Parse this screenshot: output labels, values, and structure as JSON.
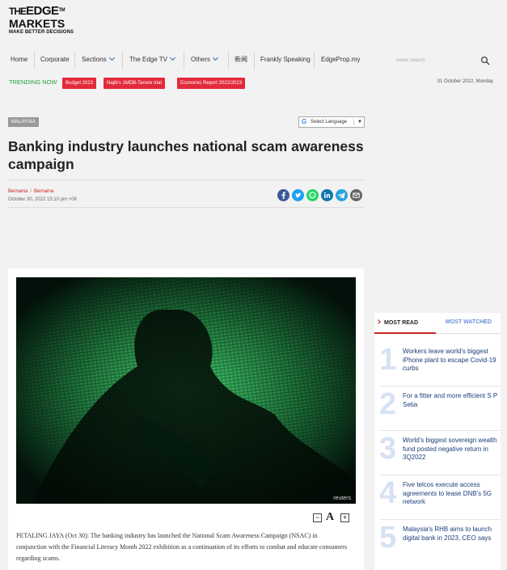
{
  "brand": {
    "line1_prefix": "THE",
    "line1_main": "EDGE",
    "tm": "TM",
    "line2": "MARKETS",
    "tagline": "MAKE BETTER DECISIONS"
  },
  "nav": {
    "items": [
      {
        "label": "Home"
      },
      {
        "label": "Corporate"
      },
      {
        "label": "Sections"
      },
      {
        "label": "The Edge TV"
      },
      {
        "label": "Others"
      },
      {
        "label": "新闻"
      },
      {
        "label": "Frankly Speaking"
      },
      {
        "label": "EdgeProp.my"
      }
    ],
    "search_placeholder": "News Search"
  },
  "trending": {
    "label": "TRENDING NOW",
    "tags": [
      "Budget 2023",
      "Najib's 1MDB-Tanore trial",
      "Economic Report 2022/2023"
    ],
    "date": "31 October 2022, Monday"
  },
  "article": {
    "category": "MALAYSIA",
    "language_selector": "Select Language",
    "language_arrow": "▼",
    "title": "Banking industry launches national scam awareness campaign",
    "author1": "Bernama",
    "author2": "Bernama",
    "byline_separator": "/",
    "published": "October 30, 2022 15:10 pm +08",
    "image_credit": "reuters",
    "font_minus": "−",
    "font_a": "A",
    "font_plus": "+",
    "body": "PETALING JAYA (Oct 30): The banking industry has launched the National Scam Awareness Campaign (NSAC) in conjunction with the Financial Literacy Month 2022 exhibition as a continuation of its efforts to combat and educate consumers regarding scams.",
    "share": [
      "facebook-icon",
      "twitter-icon",
      "whatsapp-icon",
      "linkedin-icon",
      "telegram-icon",
      "email-icon"
    ]
  },
  "sidebar": {
    "tab_most_read": "MOST READ",
    "tab_most_watched": "MOST WATCHED",
    "items": [
      {
        "num": "1",
        "text": "Workers leave world's biggest iPhone plant to escape Covid-19 curbs"
      },
      {
        "num": "2",
        "text": "For a fitter and more efficient S P Setia"
      },
      {
        "num": "3",
        "text": "World's biggest sovereign wealth fund posted negative return in 3Q2022"
      },
      {
        "num": "4",
        "text": "Five telcos execute access agreements to lease DNB's 5G network"
      },
      {
        "num": "5",
        "text": "Malaysia's RHB aims to launch digital bank in 2023, CEO says"
      }
    ]
  },
  "colors": {
    "accent_red": "#e22a3a",
    "trending_green": "#22a13c",
    "link_blue": "#1a3e7a",
    "nav_chevron": "#2a6bb0"
  }
}
